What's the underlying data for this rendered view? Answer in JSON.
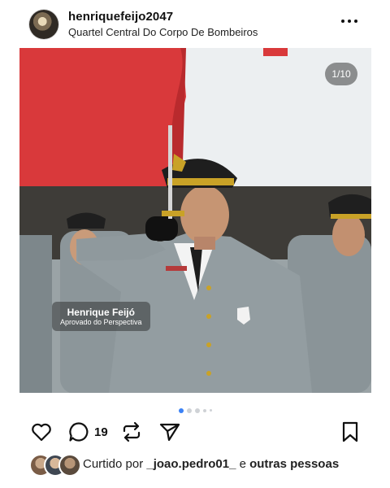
{
  "post": {
    "username": "henriquefeijo2047",
    "location": "Quartel Central Do Corpo De Bombeiros",
    "more_icon": "more-horizontal-icon",
    "media": {
      "counter": "1/10",
      "tag_name": "Henrique Feijó",
      "tag_subtitle": "Aprovado do Perspectiva",
      "carousel_index": 1,
      "carousel_dots": 5
    },
    "actions": {
      "like_icon": "heart-icon",
      "comment_icon": "comment-icon",
      "comment_count": "19",
      "repost_icon": "repost-icon",
      "share_icon": "send-icon",
      "save_icon": "bookmark-icon"
    },
    "liked_by": {
      "prefix": "Curtido por",
      "user": "_joao.pedro01_",
      "connector": "e",
      "others": "outras pessoas"
    }
  },
  "colors": {
    "accent": "#3b82f6",
    "text": "#111111",
    "flag_red": "#d9393b"
  }
}
